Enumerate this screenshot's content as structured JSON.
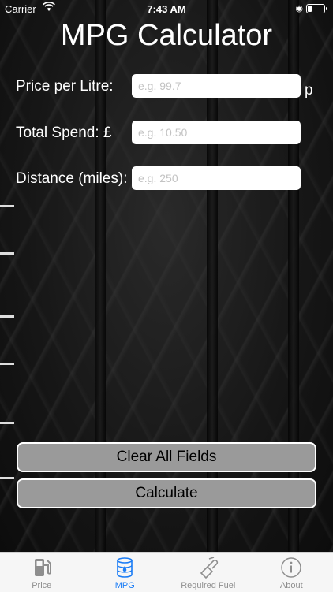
{
  "status_bar": {
    "carrier": "Carrier",
    "time": "7:43 AM"
  },
  "title": "MPG Calculator",
  "fields": [
    {
      "label": "Price per Litre:",
      "placeholder": "e.g. 99.7",
      "value": "",
      "unit": "p"
    },
    {
      "label": "Total Spend: £",
      "placeholder": "e.g. 10.50",
      "value": ""
    },
    {
      "label": "Distance (miles):",
      "placeholder": "e.g. 250",
      "value": ""
    }
  ],
  "buttons": {
    "clear": "Clear All Fields",
    "calculate": "Calculate"
  },
  "tabs": [
    {
      "label": "Price",
      "icon": "fuel-pump-icon",
      "active": false
    },
    {
      "label": "MPG",
      "icon": "fuel-drum-icon",
      "active": true
    },
    {
      "label": "Required Fuel",
      "icon": "fuel-nozzle-icon",
      "active": false
    },
    {
      "label": "About",
      "icon": "info-icon",
      "active": false
    }
  ],
  "colors": {
    "active_tab": "#1a7cf5",
    "inactive_tab": "#8e8e8e",
    "button_bg": "#9a9a9a"
  }
}
